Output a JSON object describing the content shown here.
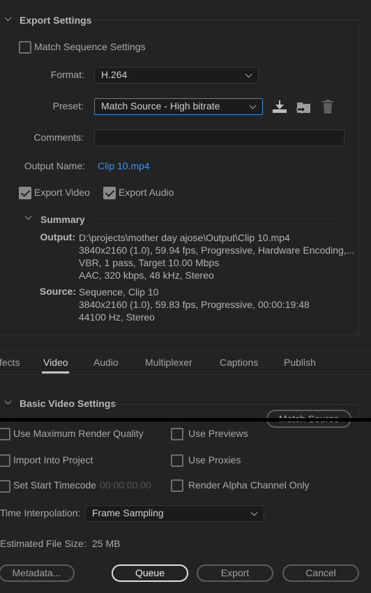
{
  "export_settings": {
    "title": "Export Settings",
    "match_sequence": {
      "label": "Match Sequence Settings",
      "checked": false
    },
    "format": {
      "label": "Format:",
      "value": "H.264"
    },
    "preset": {
      "label": "Preset:",
      "value": "Match Source - High bitrate"
    },
    "preset_icons": [
      "save-preset-icon",
      "import-preset-icon",
      "delete-preset-icon"
    ],
    "comments": {
      "label": "Comments:",
      "value": ""
    },
    "output_name": {
      "label": "Output Name:",
      "value": "Clip 10.mp4"
    },
    "export_video": {
      "label": "Export Video",
      "checked": true
    },
    "export_audio": {
      "label": "Export Audio",
      "checked": true
    },
    "summary": {
      "title": "Summary",
      "output_label": "Output:",
      "output_lines": [
        "D:\\projects\\mother day ajose\\Output\\Clip 10.mp4",
        "3840x2160 (1.0), 59.94 fps, Progressive, Hardware Encoding,...",
        "VBR, 1 pass, Target 10.00 Mbps",
        "AAC, 320 kbps, 48 kHz, Stereo"
      ],
      "source_label": "Source:",
      "source_lines": [
        "Sequence, Clip 10",
        "3840x2160 (1.0), 59.83 fps, Progressive, 00:00:19:48",
        "44100 Hz, Stereo"
      ]
    }
  },
  "tabs": [
    {
      "label": "fects",
      "active": false
    },
    {
      "label": "Video",
      "active": true
    },
    {
      "label": "Audio",
      "active": false
    },
    {
      "label": "Multiplexer",
      "active": false
    },
    {
      "label": "Captions",
      "active": false
    },
    {
      "label": "Publish",
      "active": false
    }
  ],
  "basic_video": {
    "title": "Basic Video Settings",
    "match_source_button": "Match Source"
  },
  "options": {
    "max_render_quality": {
      "label": "Use Maximum Render Quality",
      "checked": false
    },
    "use_previews": {
      "label": "Use Previews",
      "checked": false
    },
    "import_into_project": {
      "label": "Import Into Project",
      "checked": false
    },
    "use_proxies": {
      "label": "Use Proxies",
      "checked": false
    },
    "set_start_timecode": {
      "label": "Set Start Timecode",
      "checked": false,
      "timecode": "00:00:00:00"
    },
    "render_alpha": {
      "label": "Render Alpha Channel Only",
      "checked": false
    }
  },
  "time_interpolation": {
    "label": "Time Interpolation:",
    "value": "Frame Sampling"
  },
  "file_size": {
    "label": "Estimated File Size:",
    "value": "25 MB"
  },
  "buttons": {
    "metadata": "Metadata...",
    "queue": "Queue",
    "export": "Export",
    "cancel": "Cancel"
  },
  "colors": {
    "background": "#232323",
    "accent": "#2d8ceb",
    "link": "#3a92e6"
  }
}
